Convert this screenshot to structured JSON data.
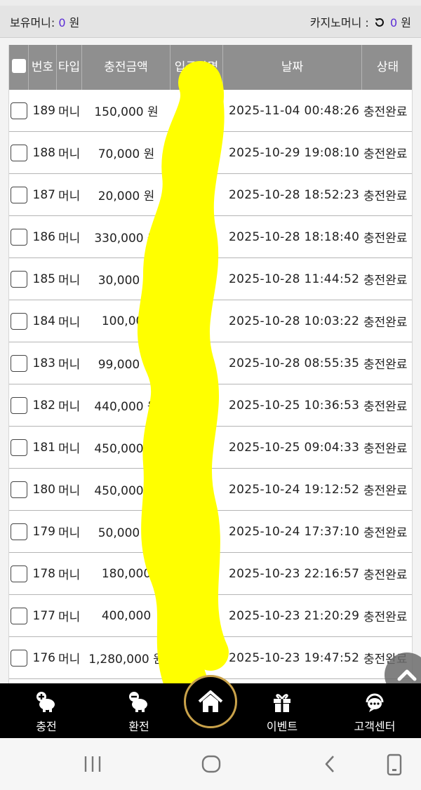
{
  "topbar": {
    "holding_label": "보유머니:",
    "holding_value": "0",
    "holding_unit": "원",
    "casino_label": "카지노머니 :",
    "casino_value": "0",
    "casino_unit": "원",
    "refresh_icon": "refresh-icon"
  },
  "table": {
    "headers": [
      "번호",
      "타입",
      "충전금액",
      "입금자명",
      "날짜",
      "상태"
    ],
    "rows": [
      {
        "no": "189",
        "type": "머니",
        "amount": "150,000 원",
        "depositor": "",
        "date": "2025-11-04 00:48:26",
        "status": "충전완료"
      },
      {
        "no": "188",
        "type": "머니",
        "amount": "70,000 원",
        "depositor": "",
        "date": "2025-10-29 19:08:10",
        "status": "충전완료"
      },
      {
        "no": "187",
        "type": "머니",
        "amount": "20,000 원",
        "depositor": "",
        "date": "2025-10-28 18:52:23",
        "status": "충전완료"
      },
      {
        "no": "186",
        "type": "머니",
        "amount": "330,000 원",
        "depositor": "",
        "date": "2025-10-28 18:18:40",
        "status": "충전완료"
      },
      {
        "no": "185",
        "type": "머니",
        "amount": "30,000 원",
        "depositor": "",
        "date": "2025-10-28 11:44:52",
        "status": "충전완료"
      },
      {
        "no": "184",
        "type": "머니",
        "amount": "100,000",
        "depositor": "",
        "date": "2025-10-28 10:03:22",
        "status": "충전완료"
      },
      {
        "no": "183",
        "type": "머니",
        "amount": "99,000 원",
        "depositor": "",
        "date": "2025-10-28 08:55:35",
        "status": "충전완료"
      },
      {
        "no": "182",
        "type": "머니",
        "amount": "440,000 원",
        "depositor": "",
        "date": "2025-10-25 10:36:53",
        "status": "충전완료"
      },
      {
        "no": "181",
        "type": "머니",
        "amount": "450,000 원",
        "depositor": "",
        "date": "2025-10-25 09:04:33",
        "status": "충전완료"
      },
      {
        "no": "180",
        "type": "머니",
        "amount": "450,000 원",
        "depositor": "",
        "date": "2025-10-24 19:12:52",
        "status": "충전완료"
      },
      {
        "no": "179",
        "type": "머니",
        "amount": "50,000 원",
        "depositor": "",
        "date": "2025-10-24 17:37:10",
        "status": "충전완료"
      },
      {
        "no": "178",
        "type": "머니",
        "amount": "180,000",
        "depositor": "",
        "date": "2025-10-23 22:16:57",
        "status": "충전완료"
      },
      {
        "no": "177",
        "type": "머니",
        "amount": "400,000",
        "depositor": "",
        "date": "2025-10-23 21:20:29",
        "status": "충전완료"
      },
      {
        "no": "176",
        "type": "머니",
        "amount": "1,280,000 원",
        "depositor": "",
        "date": "2025-10-23 19:47:52",
        "status": "충전완료"
      }
    ]
  },
  "bottom_nav": {
    "items": [
      {
        "label": "충전",
        "icon": "piggy-plus-icon"
      },
      {
        "label": "환전",
        "icon": "piggy-minus-icon"
      },
      {
        "label": "",
        "icon": "home-icon"
      },
      {
        "label": "이벤트",
        "icon": "gift-icon"
      },
      {
        "label": "고객센터",
        "icon": "headset-chat-icon"
      }
    ]
  },
  "colors": {
    "accent_number": "#5b2dd6",
    "header_bg": "#8f8f8f",
    "censor": "#ffff00",
    "home_ring": "#c9a24a"
  }
}
